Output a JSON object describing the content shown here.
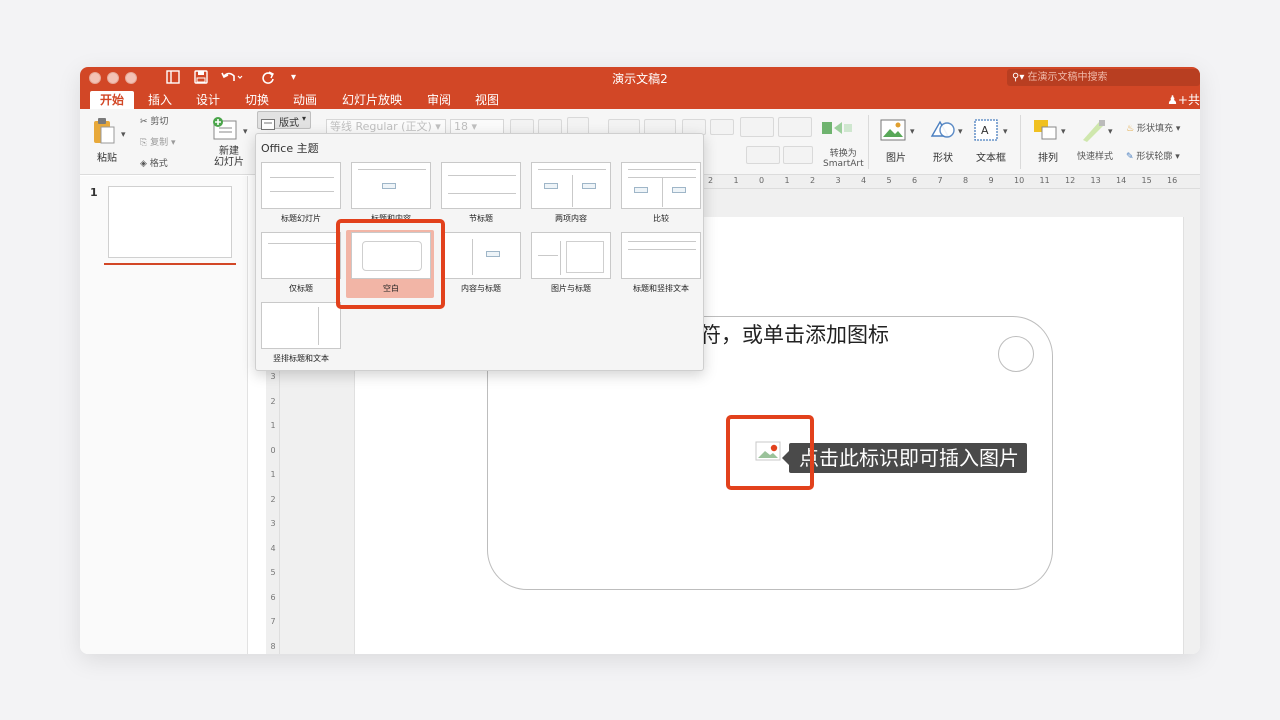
{
  "window": {
    "title": "演示文稿2",
    "search_placeholder": "在演示文稿中搜索",
    "share_label": "共"
  },
  "tabs": [
    "开始",
    "插入",
    "设计",
    "切换",
    "动画",
    "幻灯片放映",
    "审阅",
    "视图"
  ],
  "ribbon": {
    "paste": "粘贴",
    "cut": "剪切",
    "copy": "复制",
    "format_painter": "格式",
    "new_slide": "新建\n幻灯片",
    "layout_button": "版式",
    "font_name": "等线 Regular (正文)",
    "font_size": "18",
    "convert_smartart_line1": "转换为",
    "convert_smartart_line2": "SmartArt",
    "picture": "图片",
    "shape": "形状",
    "textbox": "文本框",
    "arrange": "排列",
    "quick_styles": "快速样式",
    "shape_fill": "形状填充",
    "shape_outline": "形状轮廓"
  },
  "slide_panel": {
    "slide_number": "1"
  },
  "layout_menu": {
    "header": "Office 主题",
    "items": [
      {
        "label": "标题幻灯片"
      },
      {
        "label": "标题和内容"
      },
      {
        "label": "节标题"
      },
      {
        "label": "两项内容"
      },
      {
        "label": "比较"
      },
      {
        "label": "仅标题"
      },
      {
        "label": "空白"
      },
      {
        "label": "内容与标题"
      },
      {
        "label": "图片与标题"
      },
      {
        "label": "标题和竖排文本"
      },
      {
        "label": "竖排标题和文本"
      }
    ],
    "selected": "空白"
  },
  "slide": {
    "placeholder_text": "符，或单击添加图标",
    "tooltip": "点击此标识即可插入图片"
  },
  "rulers": {
    "horizontal": [
      "2",
      "1",
      "0",
      "1",
      "2",
      "3",
      "4",
      "5",
      "6",
      "7",
      "8",
      "9",
      "10",
      "11",
      "12",
      "13",
      "14",
      "15",
      "16"
    ],
    "vertical": [
      "3",
      "2",
      "1",
      "0",
      "1",
      "2",
      "3",
      "4",
      "5",
      "6",
      "7",
      "8"
    ]
  },
  "colors": {
    "accent": "#d24726",
    "highlight": "#e2411c",
    "selected_fill": "#f2b5a6"
  }
}
